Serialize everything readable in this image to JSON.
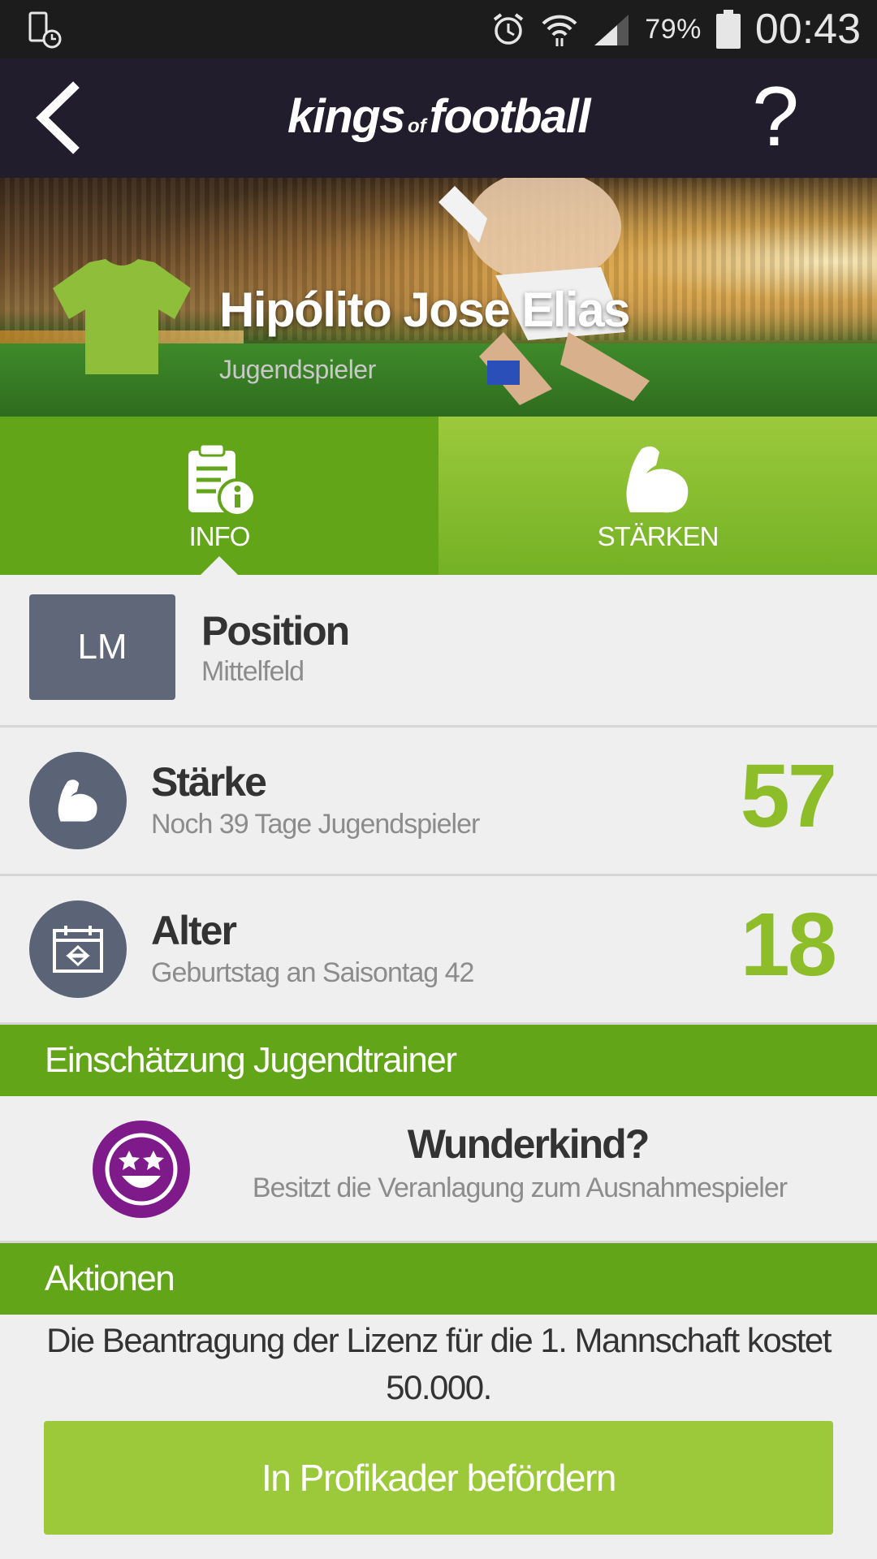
{
  "status_bar": {
    "battery_percent": "79%",
    "time": "00:43"
  },
  "app_bar": {
    "logo_main1": "kings",
    "logo_of": "of",
    "logo_main2": "football",
    "help_label": "?"
  },
  "player": {
    "name": "Hipólito Jose Elias",
    "role": "Jugendspieler",
    "shirt_color": "#8fbe3a"
  },
  "tabs": [
    {
      "label": "INFO",
      "icon": "clipboard-info-icon",
      "selected": true
    },
    {
      "label": "STÄRKEN",
      "icon": "flexed-arm-icon",
      "selected": false
    }
  ],
  "position": {
    "badge": "LM",
    "title": "Position",
    "subtitle": "Mittelfeld"
  },
  "strength": {
    "title": "Stärke",
    "subtitle": "Noch 39 Tage Jugendspieler",
    "value": "57"
  },
  "age": {
    "title": "Alter",
    "subtitle": "Geburtstag an Saisontag 42",
    "value": "18"
  },
  "coach_section": {
    "header": "Einschätzung Jugendtrainer",
    "title": "Wunderkind?",
    "subtitle": "Besitzt die Veranlagung zum Ausnahmespieler"
  },
  "actions_section": {
    "header": "Aktionen",
    "text_line1": "Die Beantragung der Lizenz für die 1. Mannschaft kostet",
    "text_line2": "50.000.",
    "button_label": "In Profikader befördern"
  },
  "colors": {
    "accent_green": "#62a519",
    "value_green": "#8ebd2a",
    "button_green": "#9bc93a",
    "header_dark": "#221d2c",
    "icon_slate": "#5b6477",
    "smiley_purple": "#7f1a8a"
  }
}
